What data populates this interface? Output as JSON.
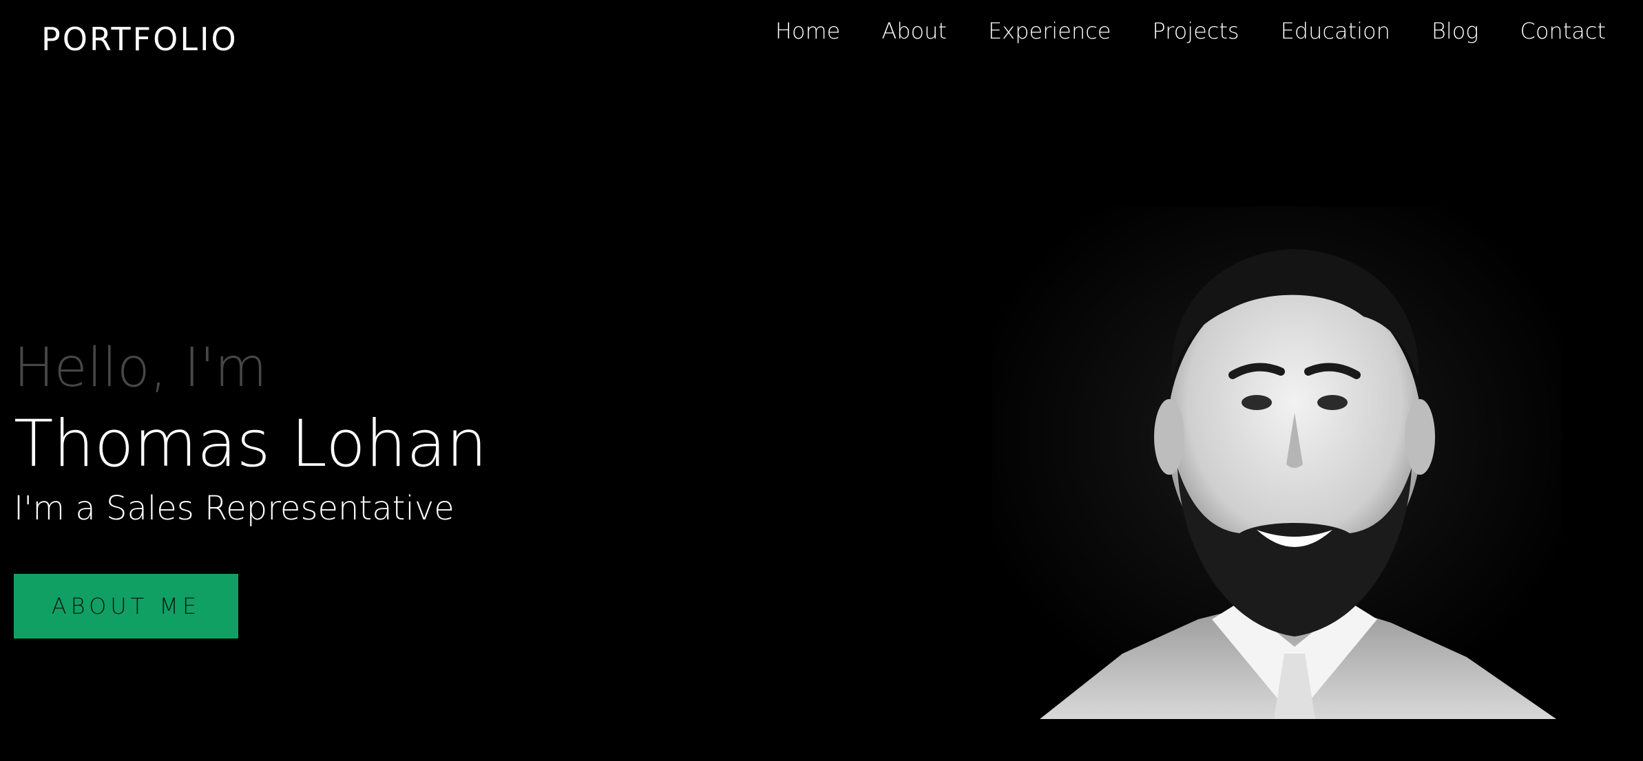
{
  "header": {
    "brand": "PORTFOLIO",
    "nav": [
      "Home",
      "About",
      "Experience",
      "Projects",
      "Education",
      "Blog",
      "Contact"
    ]
  },
  "hero": {
    "greeting": "Hello, I'm",
    "name": "Thomas Lohan",
    "role": "I'm a Sales Representative",
    "cta_label": "ABOUT ME"
  },
  "colors": {
    "background": "#000000",
    "accent": "#11a064",
    "greeting": "#474747",
    "text": "#ffffff"
  },
  "icons": {
    "portrait": "profile-photo"
  }
}
